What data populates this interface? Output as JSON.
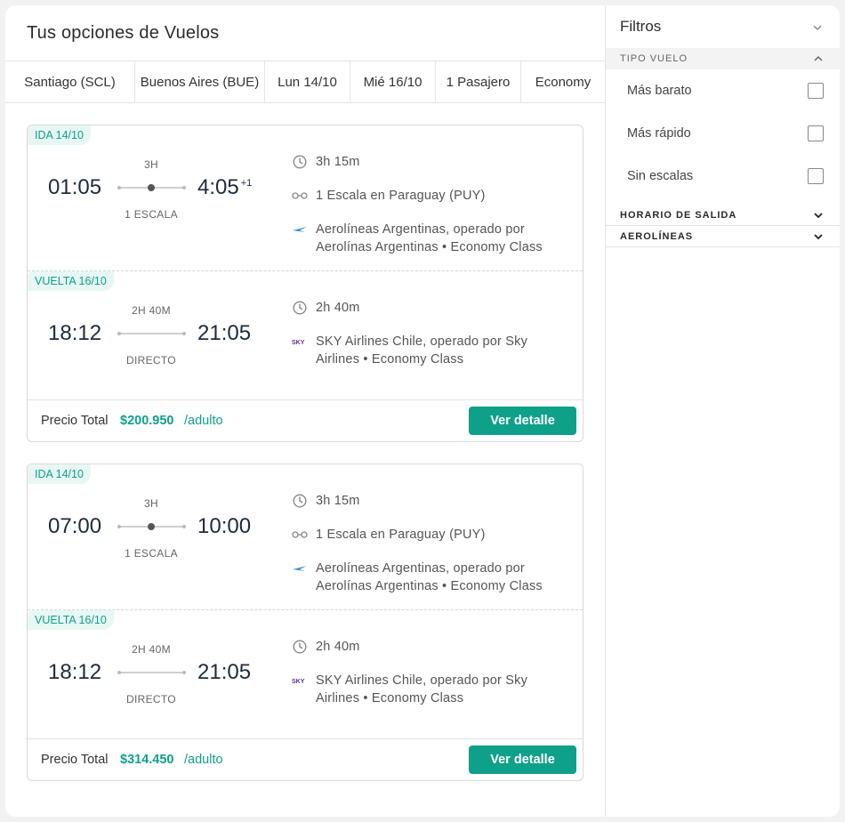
{
  "main": {
    "title": "Tus opciones de Vuelos",
    "search": {
      "origin": "Santiago (SCL)",
      "destination": "Buenos Aires (BUE)",
      "depart_date": "Lun 14/10",
      "return_date": "Mié 16/10",
      "passengers": "1 Pasajero",
      "cabin": "Economy"
    },
    "results": [
      {
        "ida": {
          "tag": "IDA 14/10",
          "dep_time": "01:05",
          "arr_time": "4:05",
          "arr_plus": "+1",
          "duration_short": "3H",
          "stops": "1 ESCALA",
          "duration": "3h 15m",
          "layover": "1 Escala en Paraguay (PUY)",
          "airline": "Aerolíneas Argentinas, operado por Aerolínas Argentinas • Economy Class"
        },
        "vuelta": {
          "tag": "VUELTA 16/10",
          "dep_time": "18:12",
          "arr_time": "21:05",
          "duration_short": "2H 40M",
          "stops": "DIRECTO",
          "duration": "2h 40m",
          "airline": "SKY Airlines Chile, operado por Sky Airlines • Economy Class"
        },
        "price_label": "Precio Total",
        "price": "$200.950",
        "per": "/adulto",
        "button": "Ver detalle"
      },
      {
        "ida": {
          "tag": "IDA 14/10",
          "dep_time": "07:00",
          "arr_time": "10:00",
          "duration_short": "3H",
          "stops": "1 ESCALA",
          "duration": "3h 15m",
          "layover": "1 Escala en Paraguay (PUY)",
          "airline": "Aerolíneas Argentinas, operado por Aerolínas Argentinas • Economy Class"
        },
        "vuelta": {
          "tag": "VUELTA 16/10",
          "dep_time": "18:12",
          "arr_time": "21:05",
          "duration_short": "2H 40M",
          "stops": "DIRECTO",
          "duration": "2h 40m",
          "airline": "SKY Airlines Chile, operado por Sky Airlines • Economy Class"
        },
        "price_label": "Precio Total",
        "price": "$314.450",
        "per": "/adulto",
        "button": "Ver detalle"
      }
    ]
  },
  "sidebar": {
    "title": "Filtros",
    "tipo_vuelo": {
      "heading": "TIPO VUELO",
      "options": [
        "Más barato",
        "Más rápido",
        "Sin escalas"
      ]
    },
    "horario_salida": "HORARIO DE SALIDA",
    "aerolineas": "AEROLÍNEAS"
  },
  "colors": {
    "accent": "#0fa08a",
    "tag_bg": "#e7f7f3",
    "time_text": "#1e2b3c"
  },
  "icons": {
    "duration": "clock-icon",
    "layover": "link-icon",
    "airline_ar": "aerolineas-argentinas-logo",
    "airline_sky": "sky-airlines-logo"
  }
}
